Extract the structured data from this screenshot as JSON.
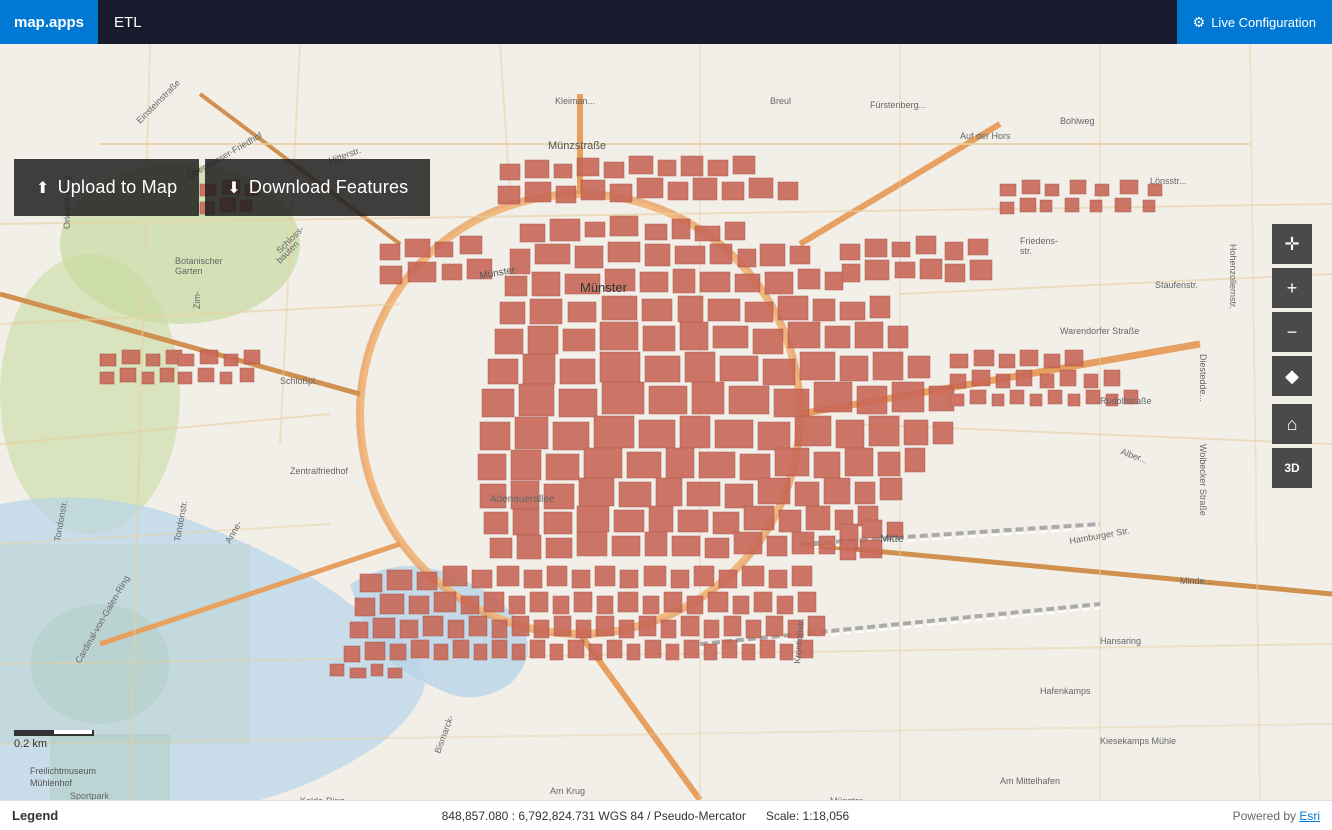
{
  "topbar": {
    "brand": "map.apps",
    "product": "ETL",
    "live_config_label": "Live Configuration",
    "gear_icon": "⚙"
  },
  "buttons": {
    "upload_icon": "⬆",
    "upload_label": "Upload to Map",
    "download_icon": "⬇",
    "download_label": "Download Features"
  },
  "controls": {
    "compass": "✛",
    "zoom_in": "+",
    "zoom_out": "−",
    "diamond": "◆",
    "home": "⌂",
    "threed": "3D"
  },
  "statusbar": {
    "legend": "Legend",
    "coordinates": "848,857.080 : 6,792,824.731  WGS 84 / Pseudo-Mercator",
    "scale": "Scale: 1:18,056",
    "powered": "Powered by ",
    "esri": "Esri"
  },
  "scalebar": {
    "label": "0.2 km"
  },
  "map": {
    "city": "Münster",
    "district": "Mitte"
  }
}
